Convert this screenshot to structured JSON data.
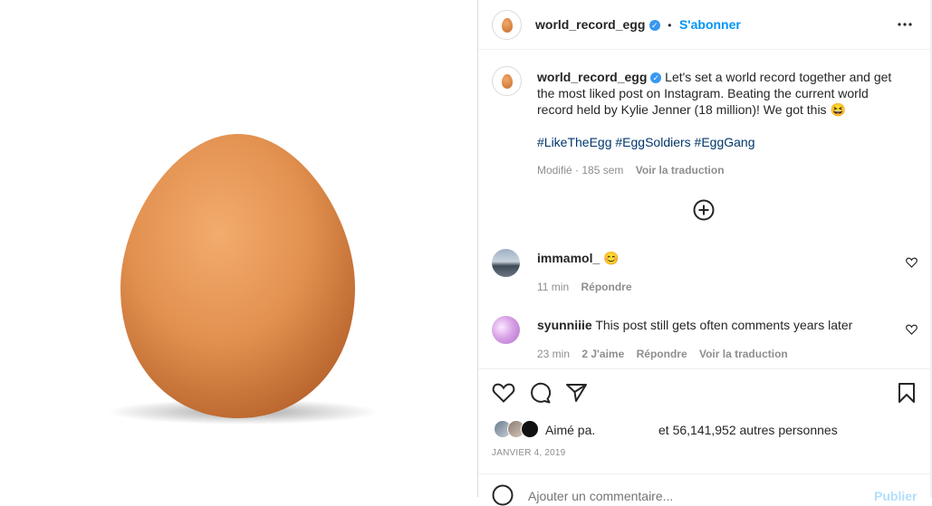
{
  "post": {
    "author": "world_record_egg",
    "verified_mark": "✓",
    "bullet": "•",
    "follow_label": "S'abonner",
    "more_icon": "more-options-icon",
    "caption_text": "Let's set a world record together and get the most liked post on Instagram. Beating the current world record held by Kylie Jenner (18 million)! We got this",
    "caption_emoji": "😆",
    "hashtags": "#LikeTheEgg #EggSoldiers #EggGang",
    "modified": "Modifié",
    "age": "185 sem",
    "translate": "Voir la traduction"
  },
  "comments": [
    {
      "user": "immamol_",
      "text": "😊",
      "time": "11 min",
      "likes": "",
      "reply": "Répondre",
      "translate": ""
    },
    {
      "user": "syunniiie",
      "text": "This post still gets often comments years later",
      "time": "23 min",
      "likes": "2 J'aime",
      "reply": "Répondre",
      "translate": "Voir la traduction"
    }
  ],
  "likes": {
    "liked_by": "Aimé pa.",
    "others": "et 56,141,952 autres personnes"
  },
  "date": "JANVIER 4, 2019",
  "comment_box": {
    "placeholder": "Ajouter un commentaire...",
    "publish": "Publier"
  },
  "colors": {
    "accent": "#0095f6",
    "egg": "#d98a4c",
    "hashtag": "#00376b"
  }
}
